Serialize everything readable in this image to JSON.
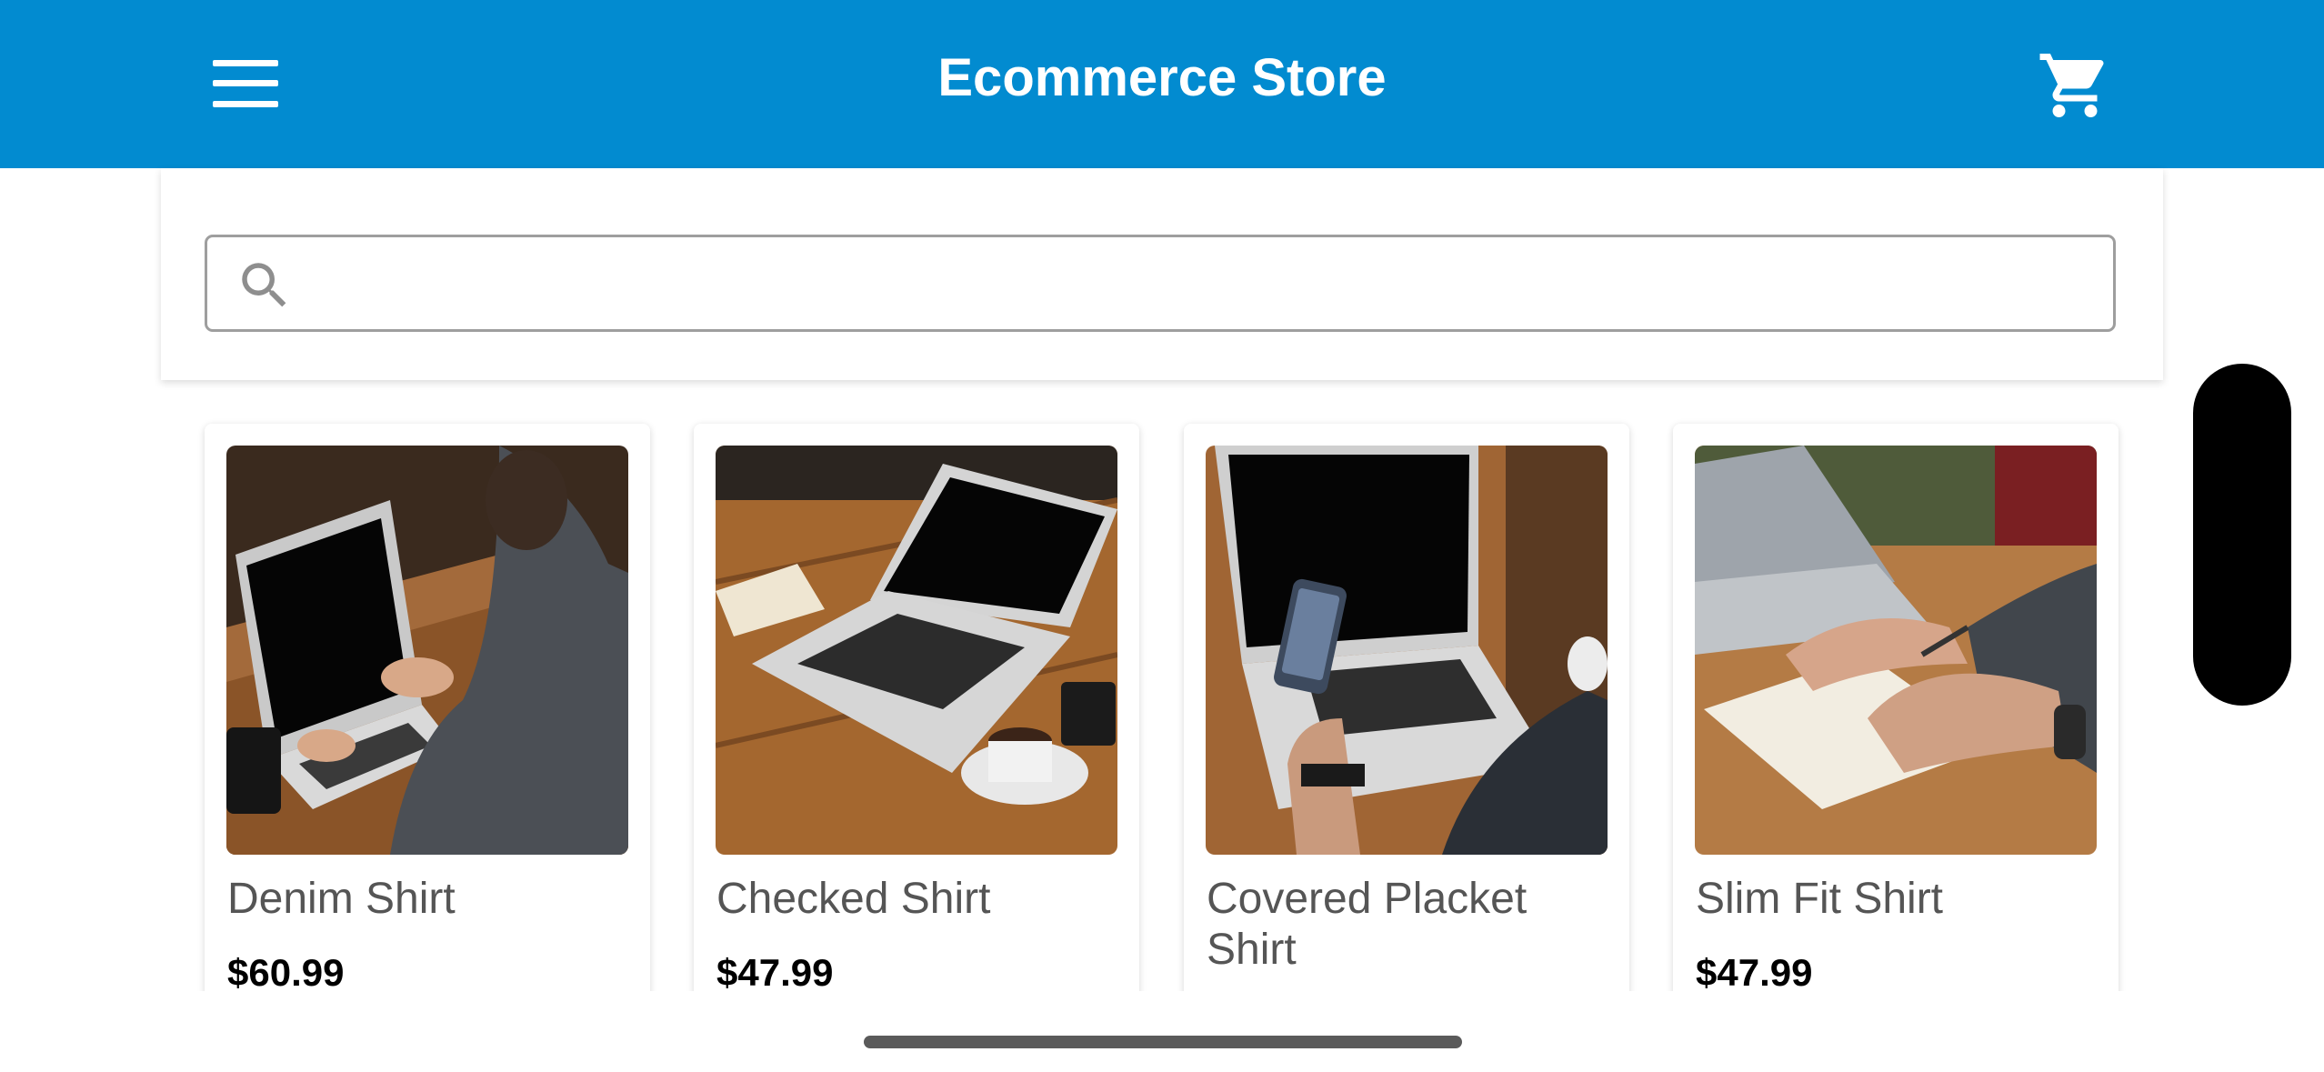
{
  "app_bar": {
    "title": "Ecommerce Store",
    "background": "#028bd0",
    "menu_icon": "hamburger-menu-icon",
    "cart_icon": "shopping-cart-icon"
  },
  "search": {
    "placeholder": "",
    "value": "",
    "icon": "search-icon"
  },
  "products": [
    {
      "name": "Denim Shirt",
      "price": "$60.99",
      "image": "person typing on laptop at wooden table"
    },
    {
      "name": "Checked Shirt",
      "price": "$47.99",
      "image": "laptop with coffee cup on wooden table"
    },
    {
      "name": "Covered Placket Shirt",
      "price": "",
      "image": "hand holding phone over laptop"
    },
    {
      "name": "Slim Fit Shirt",
      "price": "$47.99",
      "image": "hands writing in notebook beside laptop"
    }
  ]
}
